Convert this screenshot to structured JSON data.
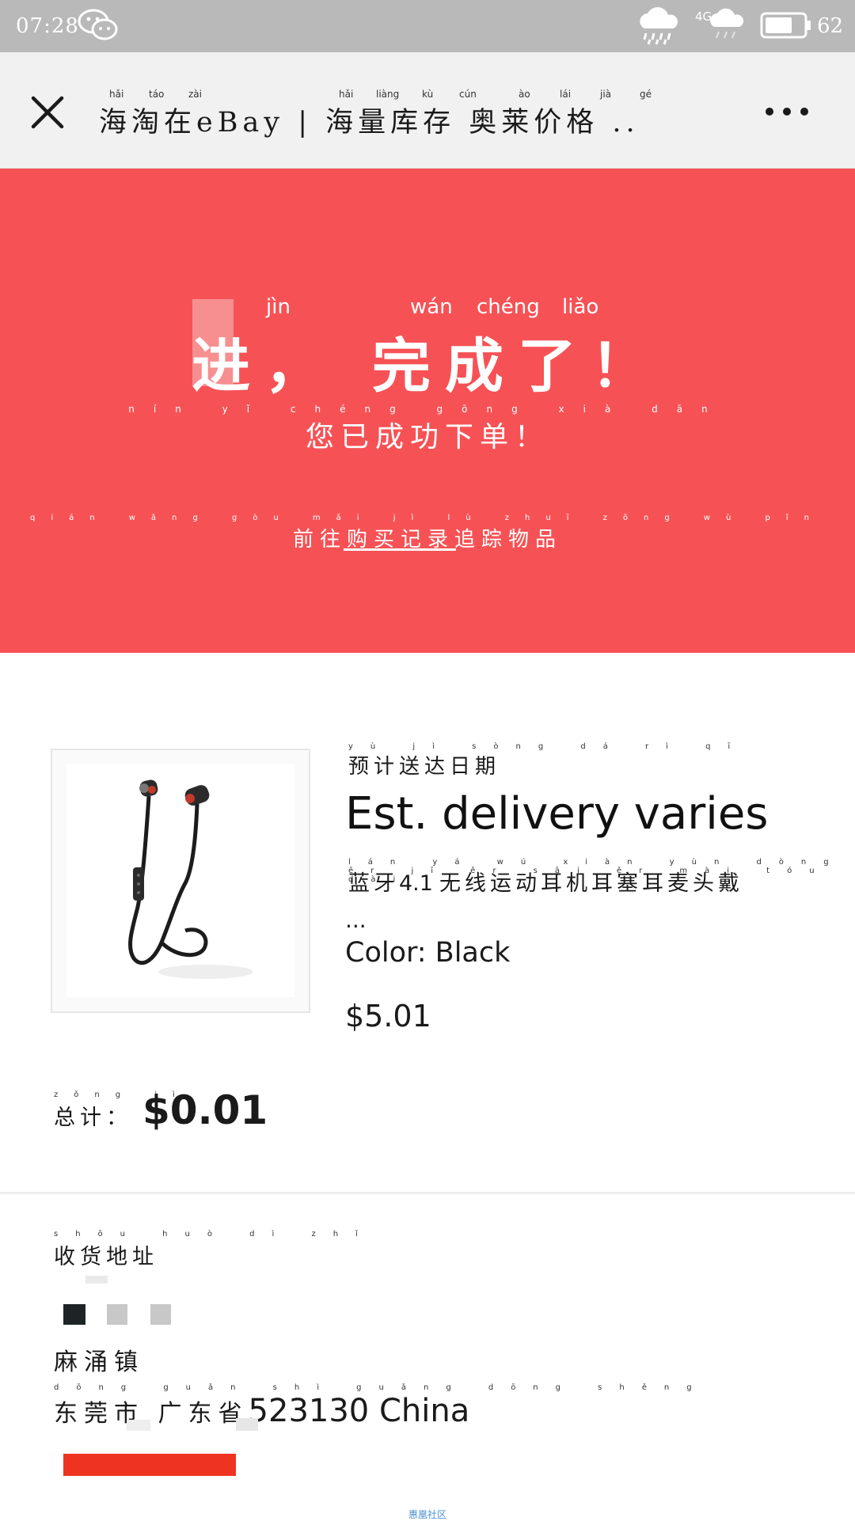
{
  "status_bar": {
    "time": "07:28",
    "network": "4G",
    "battery": "62",
    "icons": [
      "wechat-icon",
      "rain-cloud-icon",
      "cloud-icon",
      "battery-icon"
    ]
  },
  "title_bar": {
    "close_icon": "close-icon",
    "title": "海淘在eBay | 海量库存 奥莱价格 ..",
    "pinyin": [
      "hǎi",
      "táo",
      "zài",
      "hǎi",
      "liàng",
      "kù",
      "cún",
      "ào",
      "lái",
      "jià",
      "gé"
    ],
    "more_icon": "more-icon"
  },
  "hero": {
    "pinyin": [
      "jìn",
      "wán",
      "chéng",
      "liǎo"
    ],
    "title": "进， 完成了！",
    "subtitle_pinyin": "nín yǐ chéng gōng xià dān",
    "subtitle": "您已成功下单！",
    "link_pinyin": "qián wǎng gòu mǎi jì lù zhuī zōng wù pǐn",
    "link_before": "前往",
    "link": "购买记录",
    "link_after": "追踪物品",
    "background": "#f65255"
  },
  "order": {
    "delivery_pinyin": "yù jì sòng dá rì qī",
    "delivery_label": "预计送达日期",
    "delivery_value": "Est. delivery varies",
    "product_pinyin": "lán yá wú xiàn yùn dòng ěr jī ěr sāi ěr mài tóu dài",
    "product_title_cn1": "蓝牙",
    "product_title_num": "4.1",
    "product_title_cn2": "无线运动耳机耳塞耳麦头戴",
    "product_ellipsis": "...",
    "color": "Color: Black",
    "price": "$5.01",
    "total_pinyin": "zǒng jì",
    "total_label": "总计：",
    "total_value": "$0.01"
  },
  "address": {
    "label_pinyin": "shōu huò dì zhǐ",
    "label": "收货地址",
    "town": "麻涌镇",
    "city_pinyin": "dōng guǎn shì guǎng dōng shěng",
    "city_cn": "东莞市 广东省",
    "postcode": "523130 China"
  },
  "footer": {
    "watermark": "惠凰社区"
  }
}
